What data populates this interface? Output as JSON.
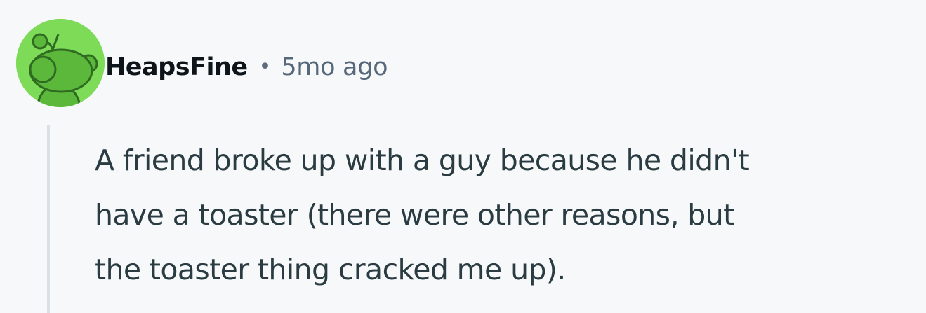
{
  "comment": {
    "author": "HeapsFine",
    "separator": "•",
    "timestamp": "5mo ago",
    "avatar_icon": "snoo-avatar-icon",
    "avatar_color": "#7ddb58",
    "body_lines": [
      "A friend broke up with a guy because he didn't",
      "have a toaster (there were other reasons, but",
      "the toaster thing cracked me up)."
    ]
  }
}
